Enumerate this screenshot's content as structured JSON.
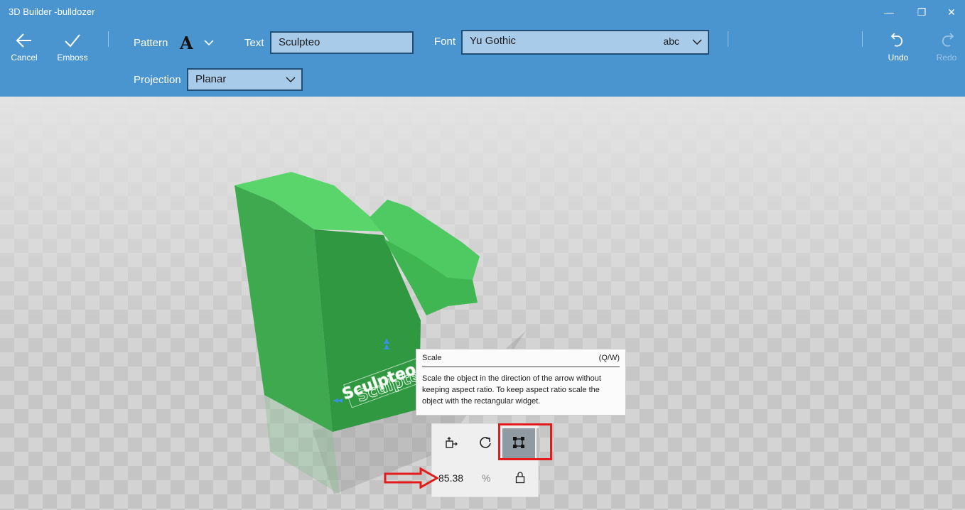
{
  "window": {
    "title": "3D Builder -bulldozer"
  },
  "window_controls": {
    "minimize": "—",
    "maximize": "❐",
    "close": "✕"
  },
  "ribbon": {
    "cancel_label": "Cancel",
    "emboss_label": "Emboss",
    "pattern_label": "Pattern",
    "pattern_glyph": "A",
    "text_label": "Text",
    "text_value": "Sculpteo",
    "font_label": "Font",
    "font_value": "Yu Gothic",
    "font_preview": "abc",
    "projection_label": "Projection",
    "projection_value": "Planar",
    "undo_label": "Undo",
    "redo_label": "Redo"
  },
  "tooltip": {
    "title": "Scale",
    "shortcut": "(Q/W)",
    "body": "Scale the object in the direction of the arrow without keeping aspect ratio. To keep aspect ratio scale the object with the rectangular widget."
  },
  "widget": {
    "scale_value": "85.38",
    "unit": "%",
    "tools": [
      "move-icon",
      "rotate-icon",
      "scale-icon"
    ],
    "active_tool": "scale"
  },
  "model": {
    "emboss_text": "Sculpteo",
    "color": "#3fae52"
  },
  "colors": {
    "ribbon": "#4a95cf",
    "model_green": "#3fae52",
    "highlight": "#e31b1b",
    "active_tool": "#8f9aa2"
  }
}
